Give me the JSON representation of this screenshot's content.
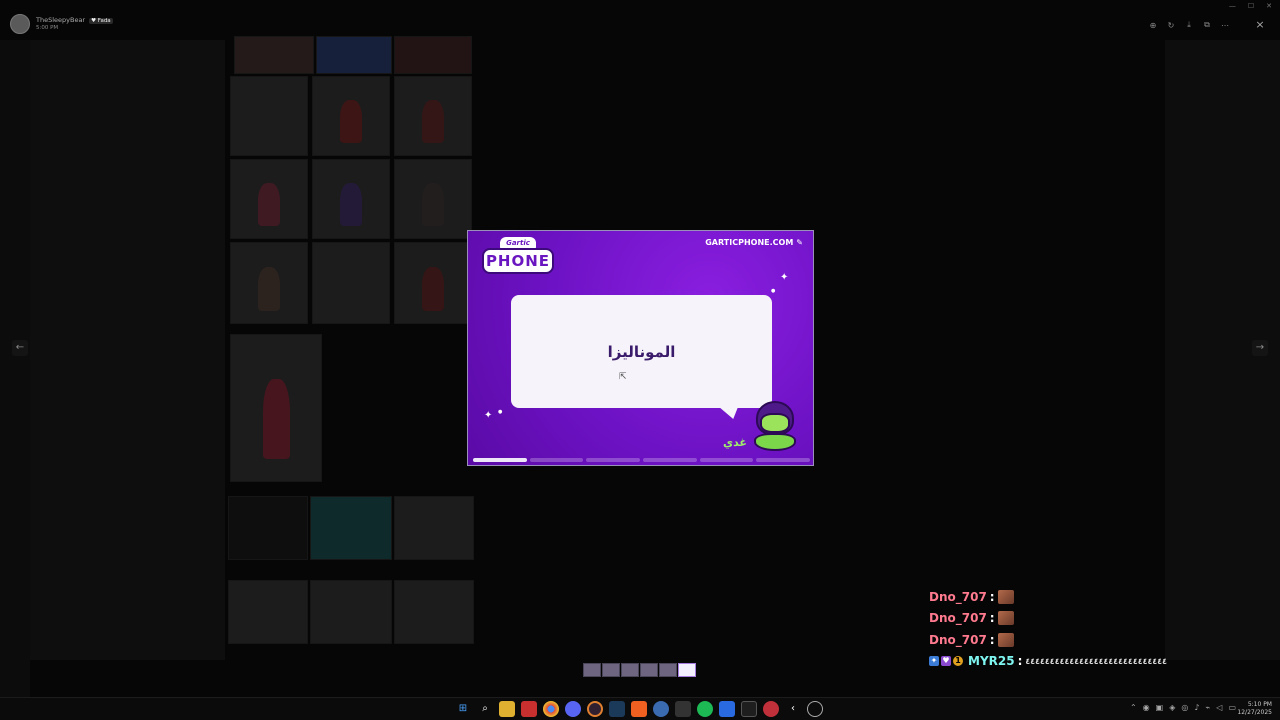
{
  "viewer": {
    "user_name": "TheSleepyBear",
    "user_badge": "♥ Fada",
    "time": "5:00 PM",
    "toolbar_icons": [
      "zoom-in-icon",
      "rotate-icon",
      "download-icon",
      "open-external-icon",
      "more-icon"
    ],
    "close_icon": "×",
    "prev_arrow": "←",
    "next_arrow": "→"
  },
  "card": {
    "logo_top": "Gartic",
    "logo_main": "PHONE",
    "site": "GARTICPHONE.COM",
    "site_icon": "✎",
    "prompt": "الموناليزا",
    "player_name": "غدي",
    "progress": {
      "total_segments": 6,
      "active_segment": 1
    }
  },
  "strip": {
    "count": 6,
    "active_index": 5
  },
  "chat": [
    {
      "name": "Dno_707",
      "message": "",
      "emote": true,
      "style": "pink"
    },
    {
      "name": "Dno_707",
      "message": "",
      "emote": true,
      "style": "pink"
    },
    {
      "name": "Dno_707",
      "message": "",
      "emote": true,
      "style": "pink"
    },
    {
      "name": "MYR25",
      "message": "٤٤٤٤٤٤٤٤٤٤٤٤٤٤٤٤٤٤٤٤٤٤٤٤٤٤٤٤٤",
      "emote": false,
      "style": "cyan",
      "badges": [
        "pin-badge",
        "heart-badge",
        "gold-badge"
      ]
    }
  ],
  "taskbar": {
    "clock_time": "5:10 PM",
    "clock_date": "12/27/2025",
    "apps": [
      "windows-start-icon",
      "search-icon",
      "file-explorer-icon",
      "media-icon",
      "chrome-icon",
      "discord-icon",
      "obs-icon",
      "steam-icon",
      "brave-icon",
      "network-icon",
      "game-icon",
      "spotify-icon",
      "store-icon",
      "excel-icon",
      "app-icon",
      "back-icon",
      "sync-icon"
    ]
  }
}
